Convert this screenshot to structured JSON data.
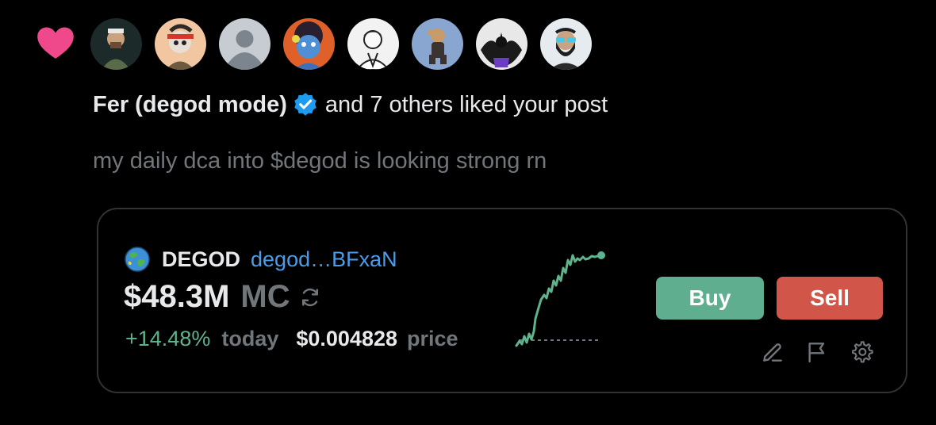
{
  "notification": {
    "type_icon": "heart-icon",
    "like_color": "#f0498b",
    "liker_name": "Fer (degod mode)",
    "verified_icon": "verified-badge-icon",
    "suffix": "and 7 others liked your post",
    "avatars": [
      {
        "name": "avatar-1",
        "bg": "#1c2a2a"
      },
      {
        "name": "avatar-2",
        "bg": "#f2c6a0"
      },
      {
        "name": "avatar-3",
        "bg": "#c6ccd2"
      },
      {
        "name": "avatar-4",
        "bg": "#e0602a"
      },
      {
        "name": "avatar-5",
        "bg": "#f2f2f2"
      },
      {
        "name": "avatar-6",
        "bg": "#88a6cf"
      },
      {
        "name": "avatar-7",
        "bg": "#e8e8e8"
      },
      {
        "name": "avatar-8",
        "bg": "#e6ebef"
      }
    ]
  },
  "post": {
    "text": "my daily dca into $degod is looking strong rn"
  },
  "token_card": {
    "ticker": "DEGOD",
    "address": "degod…BFxaN",
    "market_cap": "$48.3M",
    "market_cap_label": "MC",
    "change": "+14.48%",
    "change_label": "today",
    "price": "$0.004828",
    "price_label": "price",
    "buy_label": "Buy",
    "sell_label": "Sell",
    "icons": [
      "globe-icon",
      "refresh-icon",
      "edit-icon",
      "flag-icon",
      "settings-icon"
    ],
    "colors": {
      "positive": "#5fb38d",
      "buy": "#5fae8f",
      "sell": "#d15548",
      "link": "#4b9ce8"
    }
  }
}
